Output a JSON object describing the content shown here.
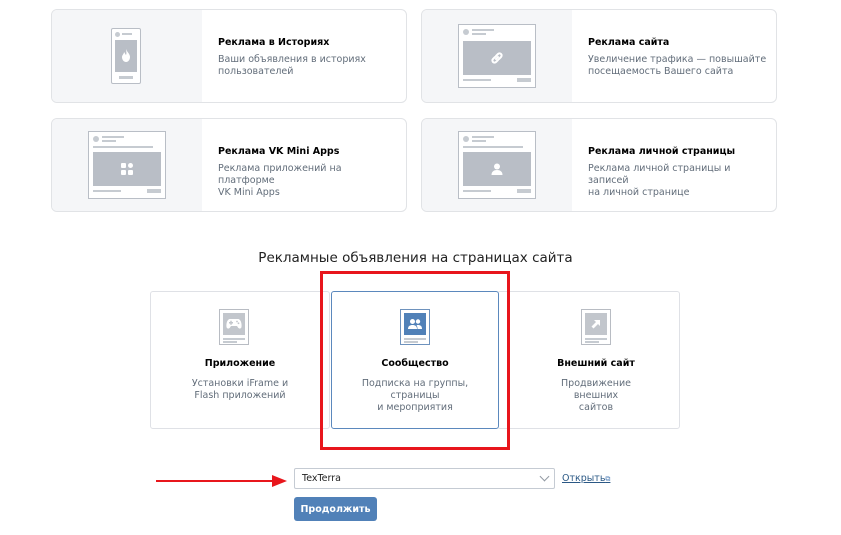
{
  "ad_formats": [
    {
      "title": "Реклама в Историях",
      "desc": [
        "Ваши объявления в историях",
        "пользователей"
      ],
      "thumb": "phone-fire-icon"
    },
    {
      "title": "Реклама сайта",
      "desc": [
        "Увеличение трафика — повышайте",
        "посещаемость Вашего сайта"
      ],
      "thumb": "link-icon"
    },
    {
      "title": "Реклама VK Mini Apps",
      "desc": [
        "Реклама приложений на платформе",
        "VK Mini Apps"
      ],
      "thumb": "apps-grid-icon"
    },
    {
      "title": "Реклама личной страницы",
      "desc": [
        "Реклама личной страницы и записей",
        "на личной странице"
      ],
      "thumb": "person-icon"
    }
  ],
  "section": {
    "title": "Рекламные объявления на страницах сайта"
  },
  "options": [
    {
      "title": "Приложение",
      "desc": [
        "Установки iFrame и",
        "Flash приложений"
      ],
      "icon": "gamepad-icon"
    },
    {
      "title": "Сообщество",
      "desc": [
        "Подписка на группы,",
        "страницы",
        "и мероприятия"
      ],
      "icon": "community-icon"
    },
    {
      "title": "Внешний сайт",
      "desc": [
        "Продвижение",
        "внешних",
        "сайтов"
      ],
      "icon": "external-link-icon"
    }
  ],
  "selected_option": "Сообщество",
  "community_select": {
    "value": "TexTerra"
  },
  "open_link": "Открыть",
  "continue_button": "Продолжить",
  "colors": {
    "accent": "#5181b8",
    "highlight": "#e8161c",
    "selected_border": "#5b88bd"
  }
}
